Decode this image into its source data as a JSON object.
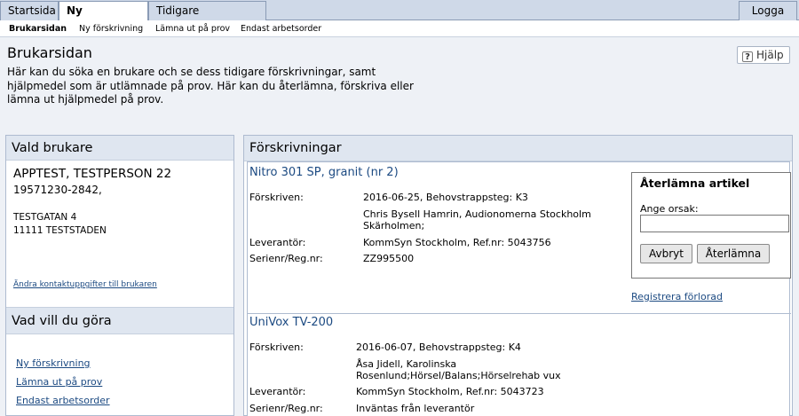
{
  "nav": {
    "tabs": [
      "Startsida",
      "Ny beställning",
      "Tidigare beställningar"
    ],
    "logout": "Logga ut",
    "subtabs": [
      "Brukarsidan",
      "Ny förskrivning",
      "Lämna ut på prov",
      "Endast arbetsorder"
    ]
  },
  "page": {
    "title": "Brukarsidan",
    "intro": "Här kan du söka en brukare och se dess tidigare förskrivningar, samt hjälpmedel som är utlämnade på prov. Här kan du återlämna, förskriva eller lämna ut hjälpmedel på prov.",
    "help": "Hjälp"
  },
  "user": {
    "heading": "Vald brukare",
    "name": "APPTEST, TESTPERSON 22",
    "pnr": "19571230-2842,",
    "street": "TESTGATAN 4",
    "city": "11111 TESTSTADEN",
    "contact_link": "Ändra kontaktuppgifter till brukaren"
  },
  "actions": {
    "heading": "Vad vill du göra",
    "links": [
      "Ny förskrivning",
      "Lämna ut på prov",
      "Endast arbetsorder"
    ]
  },
  "prescriptions": {
    "heading": "Förskrivningar",
    "labels": {
      "prescribed": "Förskriven:",
      "supplier": "Leverantör:",
      "serial": "Serienr/Reg.nr:"
    },
    "items": [
      {
        "title": "Nitro 301 SP, granit (nr 2)",
        "date": "2016-06-25, Behovstrappsteg: K3",
        "prescriber_line1": "Chris Bysell Hamrin, Audionomerna Stockholm",
        "prescriber_line2": "Skärholmen;",
        "supplier": "KommSyn Stockholm, Ref.nr: 5043756",
        "serial": "ZZ995500"
      },
      {
        "title": "UniVox TV-200",
        "date": "2016-06-07, Behovstrappsteg: K4",
        "prescriber_line1": "Åsa Jidell, Karolinska",
        "prescriber_line2": "Rosenlund;Hörsel/Balans;Hörselrehab vux",
        "supplier": "KommSyn Stockholm, Ref.nr: 5043723",
        "serial": "Inväntas från leverantör"
      }
    ]
  },
  "return_form": {
    "title": "Återlämna artikel",
    "reason_label": "Ange orsak:",
    "reason_value": "",
    "cancel": "Avbryt",
    "submit": "Återlämna",
    "lost_link": "Registrera förlorad"
  }
}
